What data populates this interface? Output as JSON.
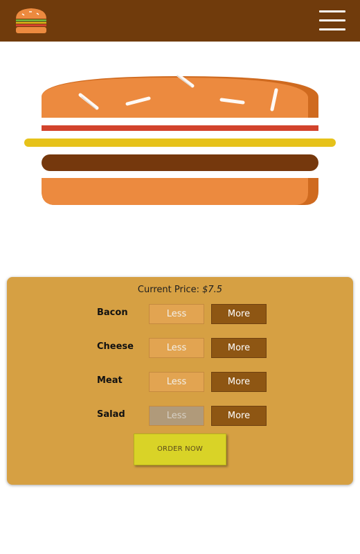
{
  "header": {
    "logo_icon": "burger-logo-icon",
    "menu_icon": "hamburger-menu-icon",
    "bar_color": "#703b0c"
  },
  "burger": {
    "layers": [
      "bun-top",
      "bacon",
      "cheese",
      "meat",
      "bun-bottom"
    ],
    "colors": {
      "bun": "#ec8a3f",
      "bun_shadow": "#cf6a1f",
      "bacon": "#d2432c",
      "cheese": "#e6c21a",
      "meat": "#75380d"
    }
  },
  "order": {
    "price_label": "Current Price:",
    "price_value": "$7.5",
    "ingredients": [
      {
        "name": "Bacon",
        "less": "Less",
        "more": "More",
        "less_enabled": true
      },
      {
        "name": "Cheese",
        "less": "Less",
        "more": "More",
        "less_enabled": true
      },
      {
        "name": "Meat",
        "less": "Less",
        "more": "More",
        "less_enabled": true
      },
      {
        "name": "Salad",
        "less": "Less",
        "more": "More",
        "less_enabled": false
      }
    ],
    "order_button": "ORDER NOW"
  }
}
